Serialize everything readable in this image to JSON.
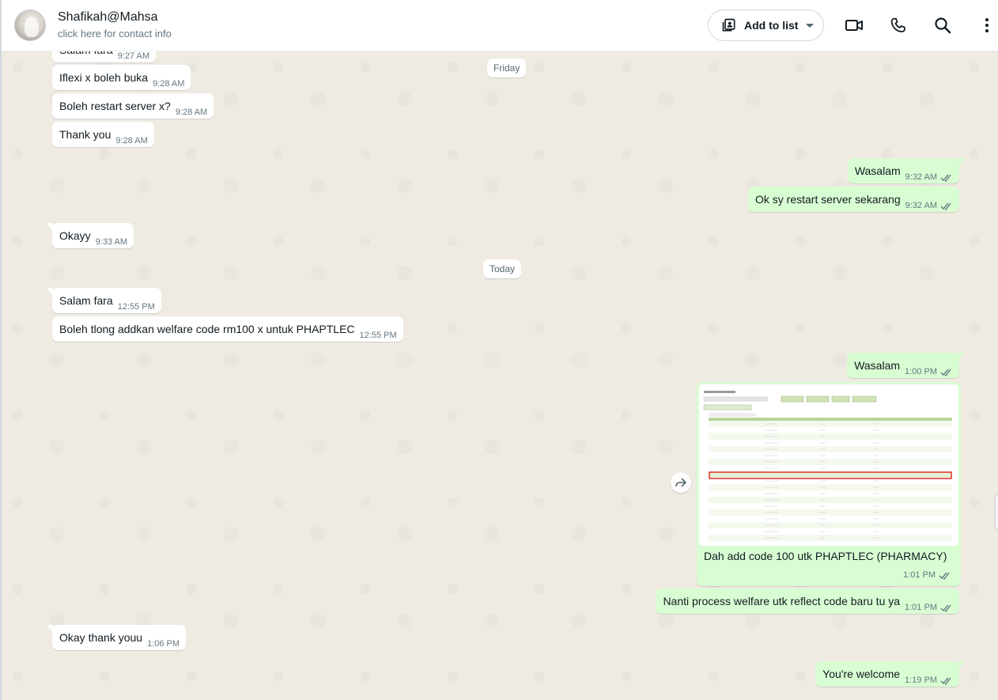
{
  "header": {
    "contact_name": "Shafikah@Mahsa",
    "contact_sub": "click here for contact info",
    "add_to_list_label": "Add to list"
  },
  "chat": {
    "date_friday": "Friday",
    "date_today": "Today",
    "messages": [
      {
        "text": "Salam fara",
        "time": "9:27 AM",
        "dir": "in"
      },
      {
        "text": "Iflexi x boleh buka",
        "time": "9:28 AM",
        "dir": "in"
      },
      {
        "text": "Boleh restart server x?",
        "time": "9:28 AM",
        "dir": "in"
      },
      {
        "text": "Thank you",
        "time": "9:28 AM",
        "dir": "in"
      },
      {
        "text": "Wasalam",
        "time": "9:32 AM",
        "dir": "out"
      },
      {
        "text": "Ok sy restart server sekarang",
        "time": "9:32 AM",
        "dir": "out"
      },
      {
        "text": "Okayy",
        "time": "9:33 AM",
        "dir": "in"
      },
      {
        "text": "Salam fara",
        "time": "12:55 PM",
        "dir": "in"
      },
      {
        "text": "Boleh tlong addkan welfare code rm100 x untuk PHAPTLEC",
        "time": "12:55 PM",
        "dir": "in"
      },
      {
        "text": "Wasalam",
        "time": "1:00 PM",
        "dir": "out"
      },
      {
        "text": "Dah add code 100 utk PHAPTLEC (PHARMACY)",
        "time": "1:01 PM",
        "dir": "out"
      },
      {
        "text": "Nanti process welfare utk reflect code baru tu ya",
        "time": "1:01 PM",
        "dir": "out"
      },
      {
        "text": "Okay thank youu",
        "time": "1:06 PM",
        "dir": "in"
      },
      {
        "text": "You're welcome",
        "time": "1:19 PM",
        "dir": "out"
      }
    ]
  },
  "colors": {
    "incoming_bubble": "#ffffff",
    "outgoing_bubble": "#d9fdd3",
    "ticks": "#667781",
    "background": "#efeae2"
  },
  "icons": {
    "add_to_list": "contact-list-icon",
    "video": "video-call-icon",
    "voice": "voice-call-icon",
    "search": "search-icon",
    "menu": "kebab-menu-icon",
    "read": "double-check-icon",
    "forward": "forward-icon"
  }
}
